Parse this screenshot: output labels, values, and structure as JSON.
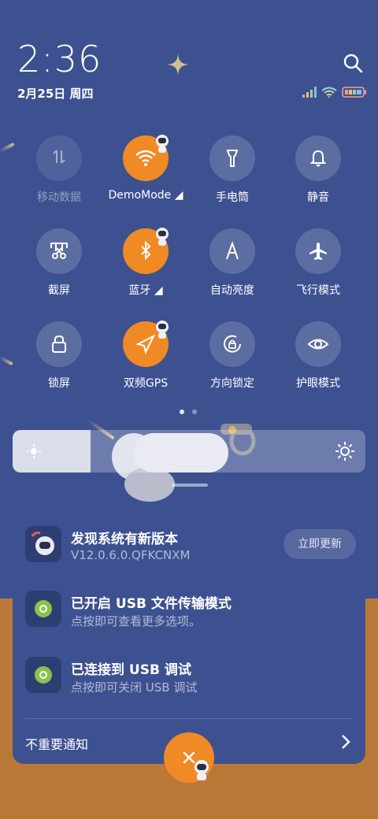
{
  "header": {
    "time": "2:36",
    "date": "2月25日 周四"
  },
  "status_icons": [
    "signal-icon",
    "wifi-icon",
    "battery-icon"
  ],
  "quick_tiles": [
    {
      "label": "移动数据",
      "icon": "mobile-data-icon",
      "state": "disabled"
    },
    {
      "label": "DemoMode ◢",
      "icon": "wifi-icon",
      "state": "on"
    },
    {
      "label": "手电筒",
      "icon": "flashlight-icon",
      "state": "off"
    },
    {
      "label": "静音",
      "icon": "bell-icon",
      "state": "off"
    },
    {
      "label": "截屏",
      "icon": "screenshot-icon",
      "state": "off"
    },
    {
      "label": "蓝牙 ◢",
      "icon": "bluetooth-icon",
      "state": "on"
    },
    {
      "label": "自动亮度",
      "icon": "auto-brightness-icon",
      "state": "off"
    },
    {
      "label": "飞行模式",
      "icon": "airplane-icon",
      "state": "off"
    },
    {
      "label": "锁屏",
      "icon": "lock-icon",
      "state": "off"
    },
    {
      "label": "双频GPS",
      "icon": "gps-icon",
      "state": "on"
    },
    {
      "label": "方向锁定",
      "icon": "rotation-lock-icon",
      "state": "off"
    },
    {
      "label": "护眼模式",
      "icon": "eye-icon",
      "state": "off"
    }
  ],
  "brightness": {
    "level": 0.22
  },
  "page_indicator": {
    "pages": 2,
    "current": 1
  },
  "notifications": [
    {
      "title": "发现系统有新版本",
      "subtitle": "V12.0.6.0.QFKCNXM",
      "action": "立即更新"
    },
    {
      "title": "已开启 USB 文件传输模式",
      "subtitle": "点按即可查看更多选项。"
    },
    {
      "title": "已连接到 USB 调试",
      "subtitle": "点按即可关闭 USB 调试"
    }
  ],
  "footer": {
    "unimportant_label": "不重要通知"
  },
  "colors": {
    "accent": "#f08a24",
    "background": "#3d5191",
    "lower_background": "#b97838"
  }
}
